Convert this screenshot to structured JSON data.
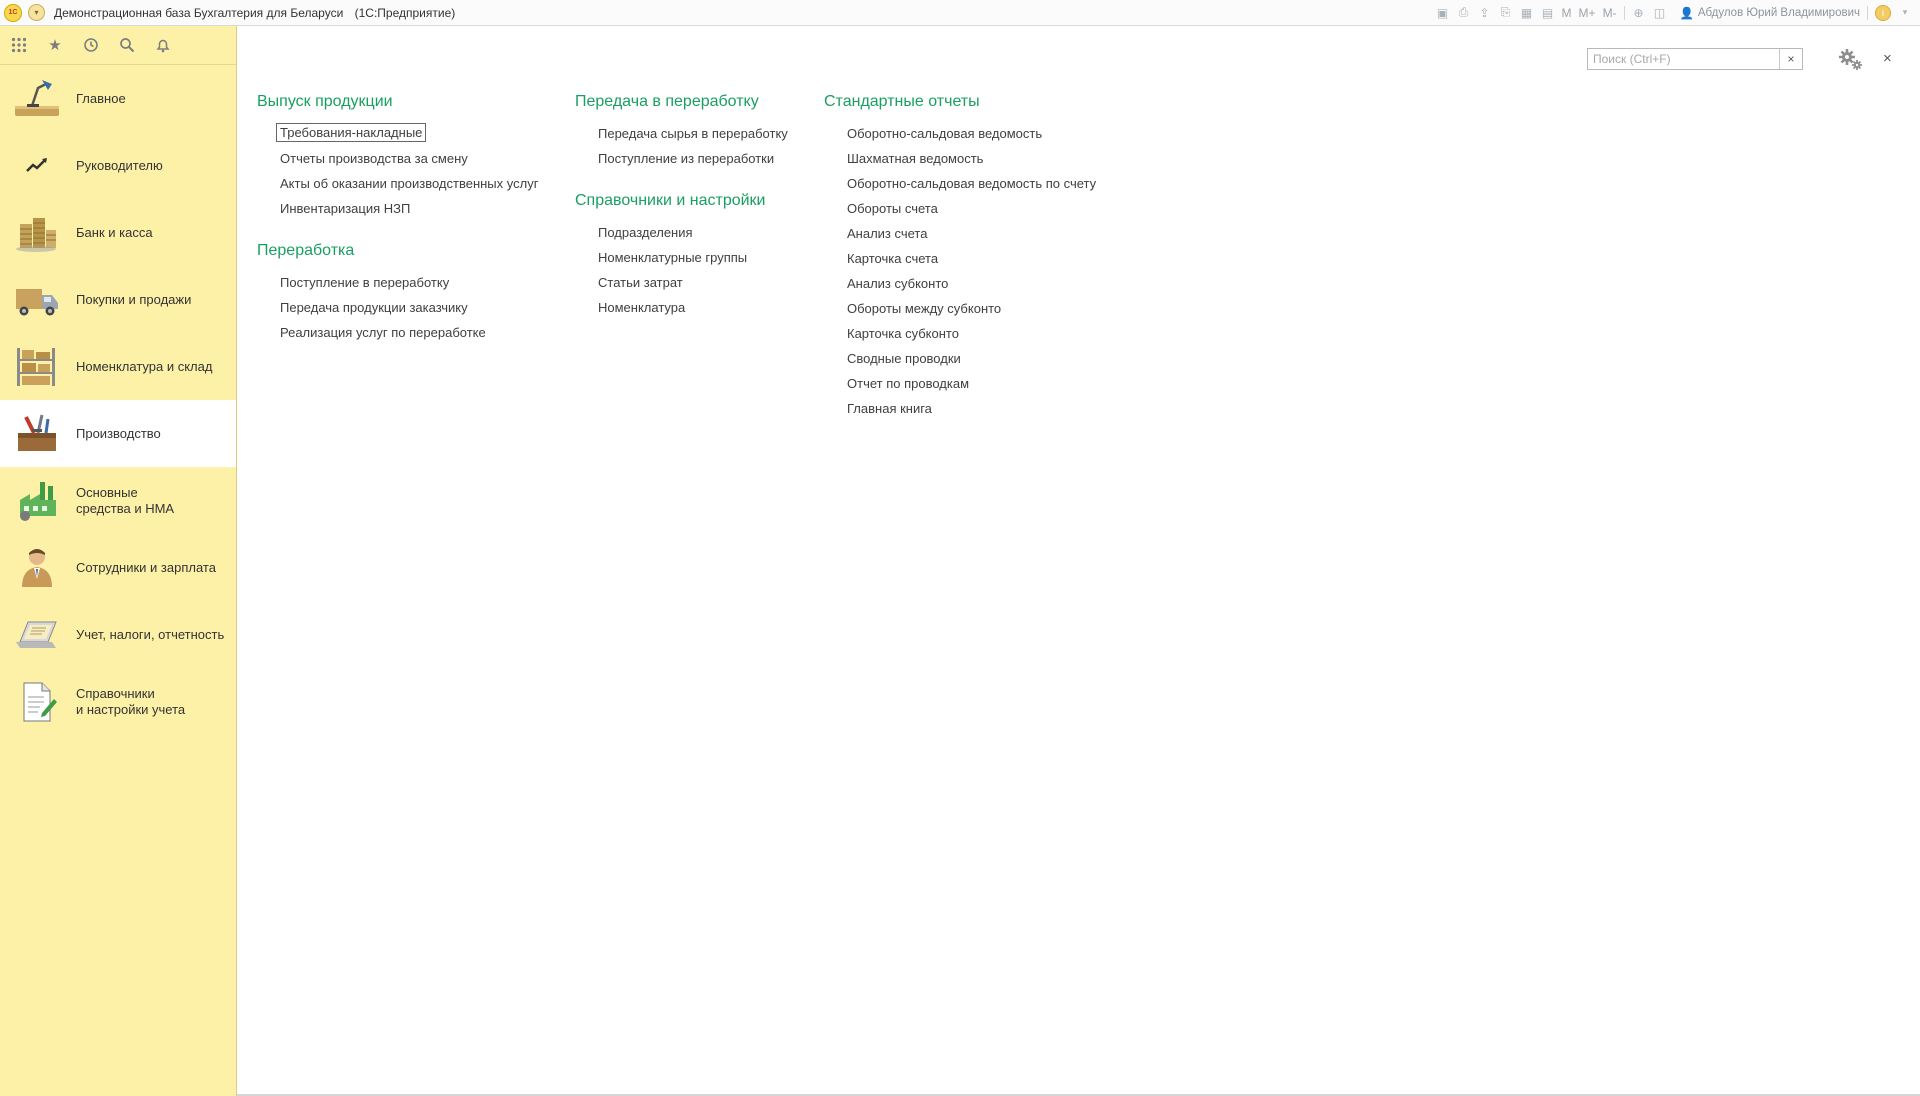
{
  "window": {
    "title": "Демонстрационная база Бухгалтерия для Беларуси",
    "subtitle": "(1С:Предприятие)",
    "user": "Абдулов Юрий Владимирович",
    "mem_buttons": [
      "M",
      "M+",
      "M-"
    ]
  },
  "sidebar": {
    "items": [
      {
        "label": "Главное",
        "icon": "desk-lamp-icon"
      },
      {
        "label": "Руководителю",
        "icon": "trend-chart-icon"
      },
      {
        "label": "Банк и касса",
        "icon": "coins-icon"
      },
      {
        "label": "Покупки и продажи",
        "icon": "delivery-truck-icon"
      },
      {
        "label": "Номенклатура и склад",
        "icon": "warehouse-shelf-icon"
      },
      {
        "label": "Производство",
        "icon": "toolbox-icon",
        "active": true
      },
      {
        "label": "Основные\nсредства и НМА",
        "icon": "factory-icon"
      },
      {
        "label": "Сотрудники и зарплата",
        "icon": "employee-icon"
      },
      {
        "label": "Учет, налоги, отчетность",
        "icon": "laptop-report-icon"
      },
      {
        "label": "Справочники\nи настройки учета",
        "icon": "document-edit-icon"
      }
    ]
  },
  "search": {
    "placeholder": "Поиск (Ctrl+F)",
    "clear": "×"
  },
  "close_label": "×",
  "sections": {
    "vypusk": {
      "title": "Выпуск продукции",
      "links": [
        "Требования-накладные",
        "Отчеты производства за смену",
        "Акты об оказании производственных услуг",
        "Инвентаризация НЗП"
      ]
    },
    "pererabotka": {
      "title": "Переработка",
      "links": [
        "Поступление в переработку",
        "Передача продукции заказчику",
        "Реализация услуг по переработке"
      ]
    },
    "peredacha": {
      "title": "Передача в переработку",
      "links": [
        "Передача сырья в переработку",
        "Поступление из переработки"
      ]
    },
    "spravochniki": {
      "title": "Справочники и настройки",
      "links": [
        "Подразделения",
        "Номенклатурные группы",
        "Статьи затрат",
        "Номенклатура"
      ]
    },
    "otchety": {
      "title": "Стандартные отчеты",
      "links": [
        "Оборотно-сальдовая ведомость",
        "Шахматная ведомость",
        "Оборотно-сальдовая ведомость по счету",
        "Обороты счета",
        "Анализ счета",
        "Карточка счета",
        "Анализ субконто",
        "Обороты между субконто",
        "Карточка субконто",
        "Сводные проводки",
        "Отчет по проводкам",
        "Главная книга"
      ]
    }
  },
  "colors": {
    "sidebar_bg": "#fdf1a8",
    "section_title": "#19a061",
    "link_text": "#404040"
  }
}
